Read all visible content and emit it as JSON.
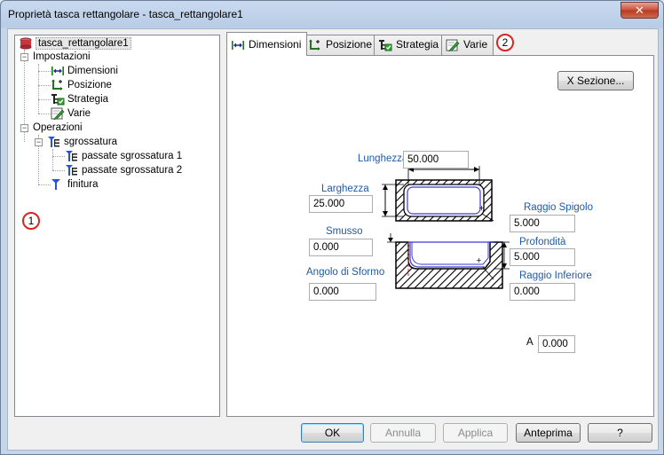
{
  "window": {
    "title": "Proprietà tasca rettangolare - tasca_rettangolare1",
    "close_glyph": "✕"
  },
  "tree": {
    "root": "tasca_rettangolare1",
    "settings": "Impostazioni",
    "settings_items": [
      "Dimensioni",
      "Posizione",
      "Strategia",
      "Varie"
    ],
    "operations": "Operazioni",
    "roughing": "sgrossatura",
    "roughing_passes": [
      "passate sgrossatura 1",
      "passate sgrossatura 2"
    ],
    "finishing": "finitura",
    "expander_collapse": "−"
  },
  "badges": {
    "tree": "1",
    "tabs": "2"
  },
  "tabs": [
    {
      "label": "Dimensioni",
      "icon": "dimension-arrows-icon",
      "active": true
    },
    {
      "label": "Posizione",
      "icon": "position-axes-icon",
      "active": false
    },
    {
      "label": "Strategia",
      "icon": "strategy-icon",
      "active": false
    },
    {
      "label": "Varie",
      "icon": "misc-pencil-icon",
      "active": false
    }
  ],
  "dimensions": {
    "section_button": "X Sezione...",
    "length_label": "Lunghezza",
    "length_value": "50.000",
    "width_label": "Larghezza",
    "width_value": "25.000",
    "corner_radius_label": "Raggio Spigolo",
    "corner_radius_value": "5.000",
    "chamfer_label": "Smusso",
    "chamfer_value": "0.000",
    "depth_label": "Profondità",
    "depth_value": "5.000",
    "draft_angle_label": "Angolo di Sformo",
    "draft_angle_value": "0.000",
    "bottom_radius_label": "Raggio Inferiore",
    "bottom_radius_value": "0.000",
    "a_label": "A",
    "a_value": "0.000"
  },
  "buttons": {
    "ok": "OK",
    "cancel": "Annulla",
    "apply": "Applica",
    "preview": "Anteprima",
    "help": "?"
  },
  "colors": {
    "label_blue": "#1e5aa8",
    "badge_red": "#dd2222",
    "icon_green": "#1a7a1a",
    "icon_blue": "#2a4fd8",
    "icon_red": "#c8363b"
  }
}
